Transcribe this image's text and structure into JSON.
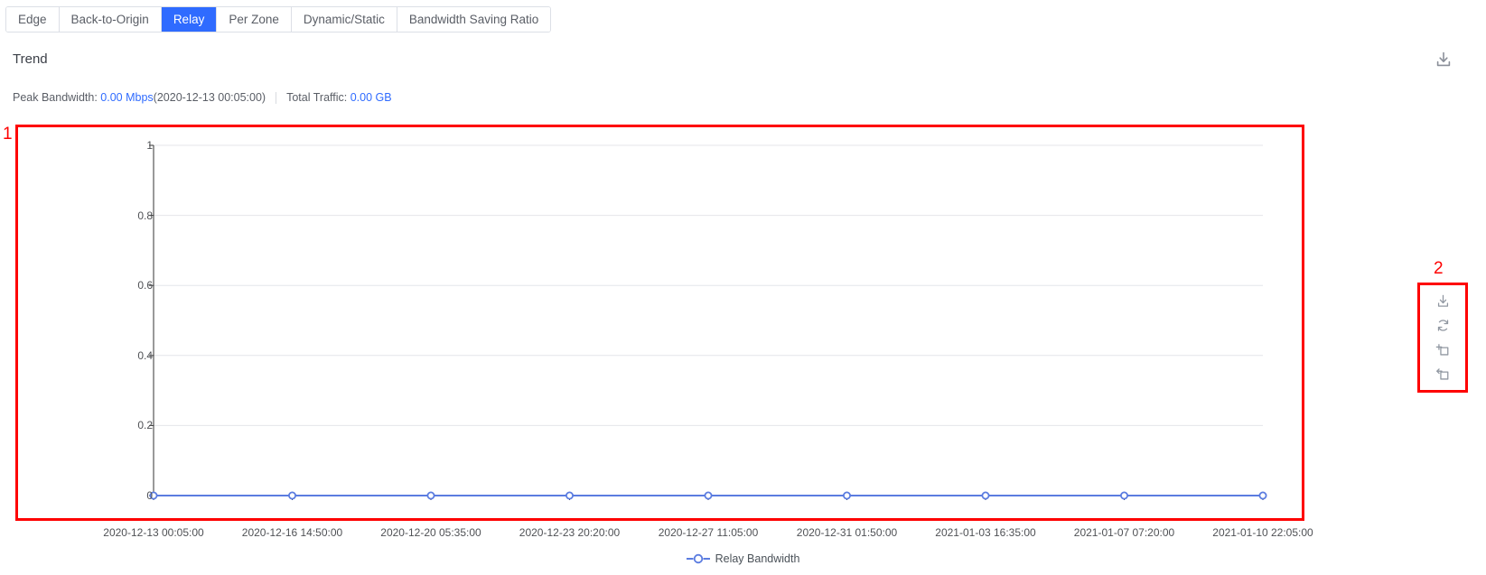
{
  "tabs": [
    {
      "label": "Edge",
      "active": false
    },
    {
      "label": "Back-to-Origin",
      "active": false
    },
    {
      "label": "Relay",
      "active": true
    },
    {
      "label": "Per Zone",
      "active": false
    },
    {
      "label": "Dynamic/Static",
      "active": false
    },
    {
      "label": "Bandwidth Saving Ratio",
      "active": false
    }
  ],
  "header": {
    "title": "Trend",
    "download_icon": "download-icon"
  },
  "summary": {
    "peak_bandwidth_label": "Peak Bandwidth:",
    "peak_bandwidth_value": "0.00 Mbps",
    "peak_bandwidth_time": "(2020-12-13 00:05:00)",
    "total_traffic_label": "Total Traffic:",
    "total_traffic_value": "0.00 GB"
  },
  "annotations": [
    {
      "number": "1",
      "target": "chart-plot-area"
    },
    {
      "number": "2",
      "target": "chart-toolbox"
    }
  ],
  "toolbox": [
    {
      "icon": "download-icon",
      "name": "save-as-image-button"
    },
    {
      "icon": "refresh-icon",
      "name": "restore-button"
    },
    {
      "icon": "zoom-box-icon",
      "name": "data-zoom-button"
    },
    {
      "icon": "zoom-back-icon",
      "name": "data-zoom-reset-button"
    }
  ],
  "colors": {
    "accent": "#2f6bff",
    "series": "#5b7ce0",
    "annotation": "#fe0000",
    "grid": "#e4e6ea",
    "axis": "#333333"
  },
  "chart_data": {
    "type": "line",
    "title": "Trend",
    "xlabel": "",
    "ylabel": "",
    "grid": true,
    "legend_position": "bottom",
    "ylim": [
      0,
      1
    ],
    "yticks": [
      "0",
      "0.2",
      "0.4",
      "0.6",
      "0.8",
      "1"
    ],
    "categories": [
      "2020-12-13 00:05:00",
      "2020-12-16 14:50:00",
      "2020-12-20 05:35:00",
      "2020-12-23 20:20:00",
      "2020-12-27 11:05:00",
      "2020-12-31 01:50:00",
      "2021-01-03 16:35:00",
      "2021-01-07 07:20:00",
      "2021-01-10 22:05:00"
    ],
    "series": [
      {
        "name": "Relay Bandwidth",
        "unit": "Mbps",
        "values": [
          0,
          0,
          0,
          0,
          0,
          0,
          0,
          0,
          0
        ]
      }
    ]
  }
}
